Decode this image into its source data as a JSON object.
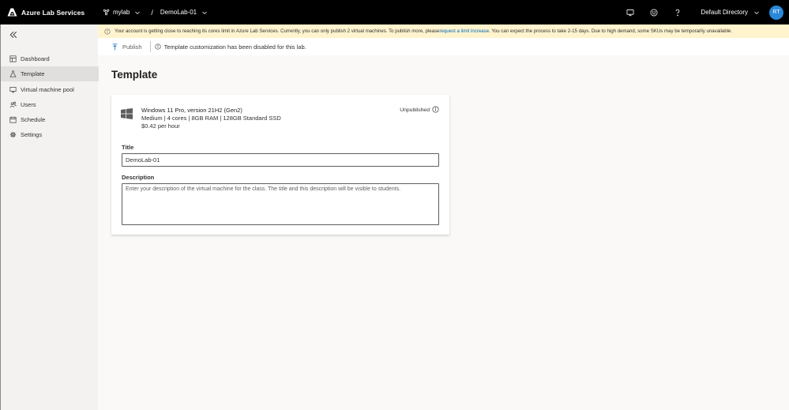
{
  "app": {
    "title": "Azure Lab Services"
  },
  "breadcrumb": {
    "lab_plan": "mylab",
    "separator": "/",
    "lab": "DemoLab-01"
  },
  "topbar": {
    "directory": "Default Directory",
    "avatar_initials": "RT"
  },
  "sidebar": {
    "items": [
      {
        "label": "Dashboard",
        "icon": "dashboard-icon",
        "active": false
      },
      {
        "label": "Template",
        "icon": "flask-icon",
        "active": true
      },
      {
        "label": "Virtual machine pool",
        "icon": "monitor-icon",
        "active": false
      },
      {
        "label": "Users",
        "icon": "users-icon",
        "active": false
      },
      {
        "label": "Schedule",
        "icon": "calendar-icon",
        "active": false
      },
      {
        "label": "Settings",
        "icon": "gear-icon",
        "active": false
      }
    ]
  },
  "banner": {
    "text_before": "Your account is getting close to reaching its cores limit in Azure Lab Services. Currently, you can only publish 2 virtual machines. To publish more, please ",
    "link": "request a limit increase",
    "text_after": ". You can expect the process to take 2-15 days. Due to high demand, some SKUs may be temporarily unavailable."
  },
  "toolbar": {
    "publish_label": "Publish",
    "info_text": "Template customization has been disabled for this lab."
  },
  "page": {
    "title": "Template"
  },
  "template": {
    "os_name": "Windows 11 Pro, version 21H2 (Gen2)",
    "spec": "Medium | 4 cores | 8GB RAM | 128GB Standard SSD",
    "price": "$0.42 per hour",
    "status": "Unpublished",
    "title_label": "Title",
    "title_value": "DemoLab-01",
    "description_label": "Description",
    "description_placeholder": "Enter your description of the virtual machine for the class. The title and this description will be visible to students."
  },
  "colors": {
    "accent": "#0067b8",
    "banner_bg": "#fff4ce",
    "avatar_bg": "#2b88d8"
  }
}
